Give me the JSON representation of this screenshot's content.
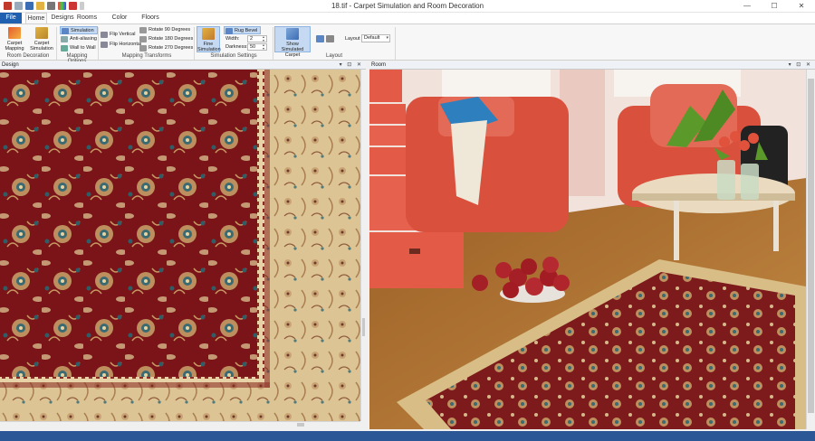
{
  "window": {
    "title": "18.tif - Carpet Simulation and Room Decoration",
    "minimize": "—",
    "maximize": "☐",
    "close": "✕"
  },
  "tabs": [
    "File",
    "Home",
    "Designs",
    "Rooms",
    "Color Palette",
    "Floors"
  ],
  "ribbon": {
    "carpet_mapping": "Carpet Mapping",
    "carpet_simulation": "Carpet Simulation",
    "simulation": "Simulation",
    "anti_aliasing": "Anti-aliasing",
    "wall_to_wall": "Wall to Wall",
    "flip_vertical": "Flip Vertical",
    "flip_horizontal": "Flip Horizontal",
    "rotate_90": "Rotate 90 Degrees",
    "rotate_180": "Rotate 180 Degrees",
    "rotate_270": "Rotate 270 Degrees",
    "fine_simulation": "Fine Simulation",
    "rug_bevel": "Rug Bevel",
    "width_label": "Width:",
    "width_value": "2",
    "darkness_label": "Darkness:",
    "darkness_value": "50",
    "show_simulated_carpet": "Show Simulated Carpet",
    "layout_label": "Layout",
    "layout_value": "Default",
    "groups": [
      "Room Decoration",
      "Mapping Options",
      "Mapping Transforms",
      "Simulation Settings",
      "Layout"
    ]
  },
  "panels": {
    "design": "Design",
    "room": "Room",
    "panel_controls": "▾ ⊡ ✕"
  },
  "colors": {
    "file_tab": "#1e5fb0",
    "carpet_red": "#7a1418",
    "carpet_beige": "#d9c08e",
    "floor": "#b2742f",
    "chair": "#d9503d",
    "status_bar": "#2b5797"
  }
}
